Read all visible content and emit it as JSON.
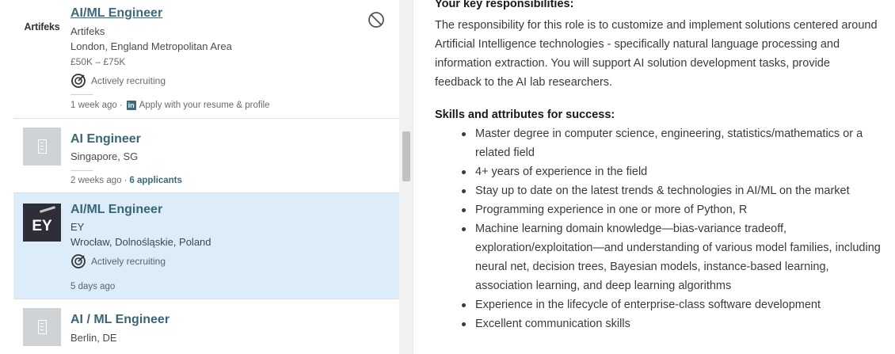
{
  "job_list": [
    {
      "title": "AI/ML Engineer",
      "company": "Artifeks",
      "logo_text": "Artifeks",
      "location": "London, England Metropolitan Area",
      "salary": "£50K – £75K",
      "recruiting": "Actively recruiting",
      "posted": "1 week ago",
      "separator": "·",
      "apply_text": "Apply with your resume & profile",
      "apply_icon": "linkedin-icon",
      "hide_icon": "block-icon"
    },
    {
      "title": "AI Engineer",
      "location": "Singapore, SG",
      "posted": "2 weeks ago",
      "separator": "·",
      "applicants": "6 applicants",
      "logo_icon": "building-icon"
    },
    {
      "title": "AI/ML Engineer",
      "company": "EY",
      "logo_text": "EY",
      "location": "Wrocław, Dolnośląskie, Poland",
      "recruiting": "Actively recruiting",
      "posted": "5 days ago"
    },
    {
      "title": "AI / ML Engineer",
      "location": "Berlin, DE",
      "logo_icon": "building-icon"
    }
  ],
  "detail": {
    "responsibilities_heading": "Your key responsibilities:",
    "responsibilities_text": "The responsibility for this role is to customize and implement solutions centered around Artificial Intelligence technologies - specifically natural language processing and information extraction. You will support AI solution development tasks, provide feedback to the AI lab researchers.",
    "skills_heading": "Skills and attributes for success:",
    "skills": [
      "Master degree in computer science, engineering, statistics/mathematics or a related field",
      "4+ years of experience in the field",
      "Stay up to date on the latest trends & technologies in AI/ML on the market",
      "Programming experience in one or more of Python, R",
      "Machine learning domain knowledge—bias-variance tradeoff, exploration/exploitation—and understanding of various model families, including neural net, decision trees, Bayesian models, instance-based learning, association learning, and deep learning algorithms",
      "Experience in the lifecycle of enterprise-class software development",
      "Excellent communication skills"
    ]
  },
  "colors": {
    "selected_card_bg": "#dcedf9",
    "title_link": "#41687a",
    "ey_logo_bg": "#2e2e38"
  }
}
